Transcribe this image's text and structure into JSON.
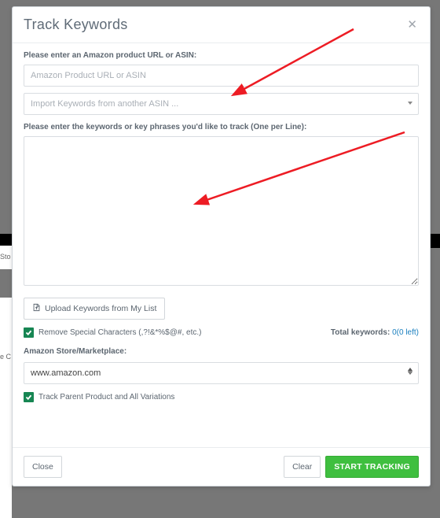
{
  "header": {
    "title": "Track Keywords"
  },
  "product": {
    "label": "Please enter an Amazon product URL or ASIN:",
    "placeholder": "Amazon Product URL or ASIN"
  },
  "import": {
    "placeholder": "Import Keywords from another ASIN ..."
  },
  "keywords": {
    "label": "Please enter the keywords or key phrases you'd like to track (One per Line):",
    "value": ""
  },
  "upload": {
    "label": "Upload Keywords from My List"
  },
  "options": {
    "remove_special": "Remove Special Characters (,?!&*%$@#, etc.)",
    "track_parent": "Track Parent Product and All Variations"
  },
  "totals": {
    "label": "Total keywords:",
    "value": "0(0 left)"
  },
  "marketplace": {
    "label": "Amazon Store/Marketplace:",
    "selected": "www.amazon.com"
  },
  "footer": {
    "close": "Close",
    "clear": "Clear",
    "start": "START TRACKING"
  }
}
